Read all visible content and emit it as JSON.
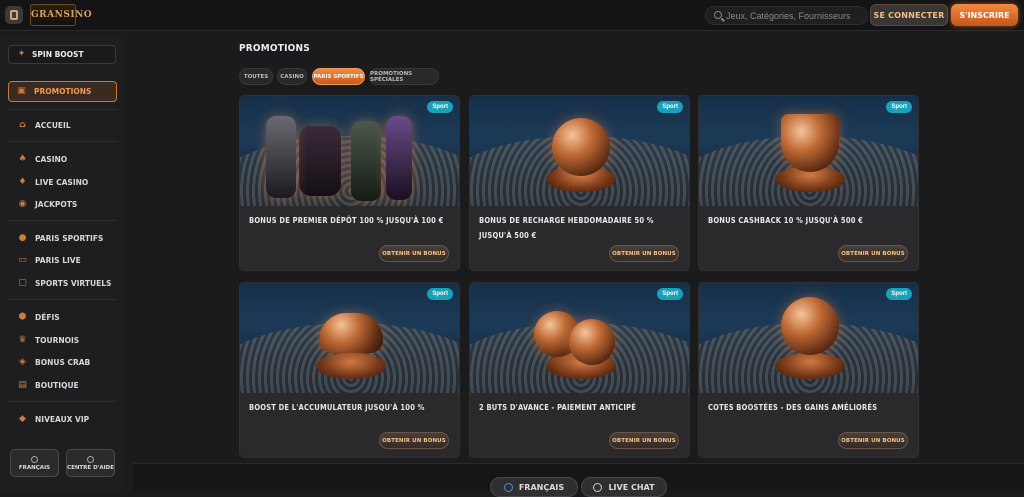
{
  "header": {
    "logo_text": "GRANSINO",
    "search_placeholder": "Jeux, Catégories, Fournisseurs",
    "login_label": "SE CONNECTER",
    "register_label": "S'INSCRIRE"
  },
  "sidebar": {
    "spin_boost": "SPIN BOOST",
    "active": "PROMOTIONS",
    "items": [
      {
        "label": "ACCUEIL",
        "icon": "home-icon"
      },
      {
        "label": "CASINO",
        "icon": "casino-icon"
      },
      {
        "label": "LIVE CASINO",
        "icon": "live-casino-icon"
      },
      {
        "label": "JACKPOTS",
        "icon": "jackpot-icon"
      },
      {
        "label": "PARIS SPORTIFS",
        "icon": "sports-icon"
      },
      {
        "label": "PARIS LIVE",
        "icon": "live-bet-icon"
      },
      {
        "label": "SPORTS VIRTUELS",
        "icon": "virtual-sports-icon"
      },
      {
        "label": "DÉFIS",
        "icon": "challenges-icon"
      },
      {
        "label": "TOURNOIS",
        "icon": "trophy-icon"
      },
      {
        "label": "BONUS CRAB",
        "icon": "crab-icon"
      },
      {
        "label": "BOUTIQUE",
        "icon": "shop-icon"
      },
      {
        "label": "NIVEAUX VIP",
        "icon": "vip-icon"
      }
    ],
    "language_label": "FRANÇAIS",
    "help_label": "CENTRE D'AIDE"
  },
  "main": {
    "title": "PROMOTIONS",
    "filters": [
      "TOUTES",
      "CASINO",
      "PARIS SPORTIFS",
      "PROMOTIONS SPÉCIALES"
    ],
    "active_filter": "PARIS SPORTIFS",
    "cards": [
      {
        "badge": "Sport",
        "title": "BONUS DE PREMIER DÉPÔT 100 % JUSQU'À 100 €",
        "button": "OBTENIR UN BONUS"
      },
      {
        "badge": "Sport",
        "title": "BONUS DE RECHARGE HEBDOMADAIRE 50 % JUSQU'À 500 €",
        "button": "OBTENIR UN BONUS"
      },
      {
        "badge": "Sport",
        "title": "BONUS CASHBACK 10 % JUSQU'À 500 €",
        "button": "OBTENIR UN BONUS"
      },
      {
        "badge": "Sport",
        "title": "BOOST DE L'ACCUMULATEUR JUSQU'À 100 %",
        "button": "OBTENIR UN BONUS"
      },
      {
        "badge": "Sport",
        "title": "2 BUTS D'AVANCE - PAIEMENT ANTICIPÉ",
        "button": "OBTENIR UN BONUS"
      },
      {
        "badge": "Sport",
        "title": "COTES BOOSTÉES - DES GAINS AMÉLIORÉS",
        "button": "OBTENIR UN BONUS"
      }
    ]
  },
  "footer": {
    "language_label": "FRANÇAIS",
    "chat_label": "LIVE CHAT"
  },
  "colors": {
    "accent": "#e8793a",
    "badge": "#1aa0b8"
  }
}
